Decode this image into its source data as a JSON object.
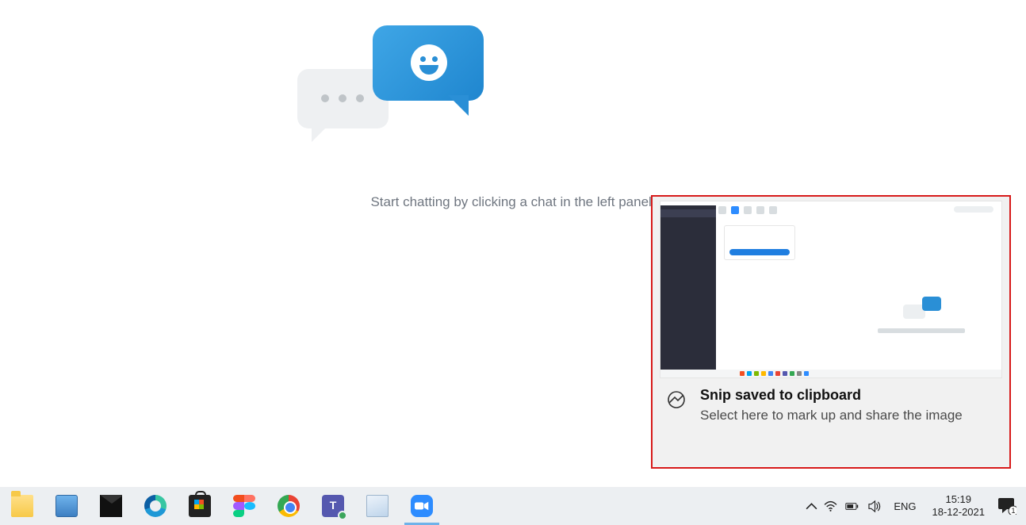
{
  "main": {
    "empty_caption": "Start chatting by clicking a chat in the left panel."
  },
  "notification": {
    "icon": "snip-icon",
    "title": "Snip saved to clipboard",
    "subtitle": "Select here to mark up and share the image"
  },
  "taskbar": {
    "apps": [
      {
        "name": "file-explorer",
        "icon": "explorer-icon"
      },
      {
        "name": "on-screen-keyboard",
        "icon": "keyboard-icon"
      },
      {
        "name": "mail",
        "icon": "mail-icon"
      },
      {
        "name": "microsoft-edge",
        "icon": "edge-icon"
      },
      {
        "name": "microsoft-store",
        "icon": "store-icon"
      },
      {
        "name": "figma",
        "icon": "figma-icon"
      },
      {
        "name": "google-chrome",
        "icon": "chrome-icon"
      },
      {
        "name": "microsoft-teams",
        "icon": "teams-icon"
      },
      {
        "name": "notepad",
        "icon": "notepad-icon"
      },
      {
        "name": "zoom",
        "icon": "zoom-icon",
        "active": true
      }
    ],
    "tray": {
      "chevron": "chevron-up-icon",
      "wifi": "wifi-icon",
      "battery": "battery-icon",
      "volume": "volume-icon",
      "language": "ENG",
      "time": "15:19",
      "date": "18-12-2021",
      "action_center": "notification-icon",
      "badge": "1"
    }
  }
}
